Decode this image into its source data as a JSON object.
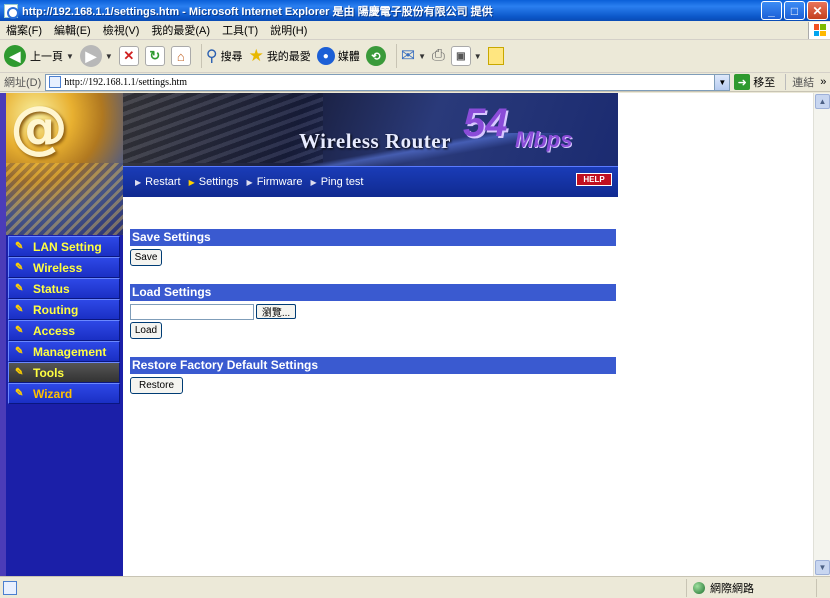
{
  "window": {
    "title": "http://192.168.1.1/settings.htm - Microsoft Internet Explorer 是由 陽慶電子股份有限公司 提供",
    "controls": {
      "minimize": "_",
      "maximize": "□",
      "close": "✕"
    }
  },
  "menubar": {
    "items": [
      "檔案(F)",
      "編輯(E)",
      "檢視(V)",
      "我的最愛(A)",
      "工具(T)",
      "說明(H)"
    ]
  },
  "toolbar": {
    "back": "上一頁",
    "search": "搜尋",
    "favorites": "我的最愛",
    "media": "媒體"
  },
  "addressbar": {
    "label": "網址(D)",
    "url": "http://192.168.1.1/settings.htm",
    "go": "移至",
    "links": "連結",
    "links_chevron": "»"
  },
  "banner": {
    "title": "Wireless Router",
    "speed": "54",
    "unit": "Mbps",
    "help": "HELP"
  },
  "topnav": {
    "items": [
      "Restart",
      "Settings",
      "Firmware",
      "Ping test"
    ]
  },
  "leftnav": {
    "logo_text": "@",
    "items": [
      "LAN Setting",
      "Wireless",
      "Status",
      "Routing",
      "Access",
      "Management",
      "Tools",
      "Wizard"
    ],
    "active": "Tools"
  },
  "sections": {
    "save": {
      "header": "Save Settings",
      "button": "Save"
    },
    "load": {
      "header": "Load Settings",
      "browse": "瀏覽...",
      "file_value": "",
      "button": "Load"
    },
    "restore": {
      "header": "Restore Factory Default Settings",
      "button": "Restore"
    }
  },
  "statusbar": {
    "zone": "網際網路"
  },
  "colors": {
    "nav_bg": "#1b1fa8",
    "nav_item": "#2e48e6",
    "nav_active": "#444444",
    "section_header": "#3a5ad0",
    "titlebar": "#0a5fd8"
  }
}
